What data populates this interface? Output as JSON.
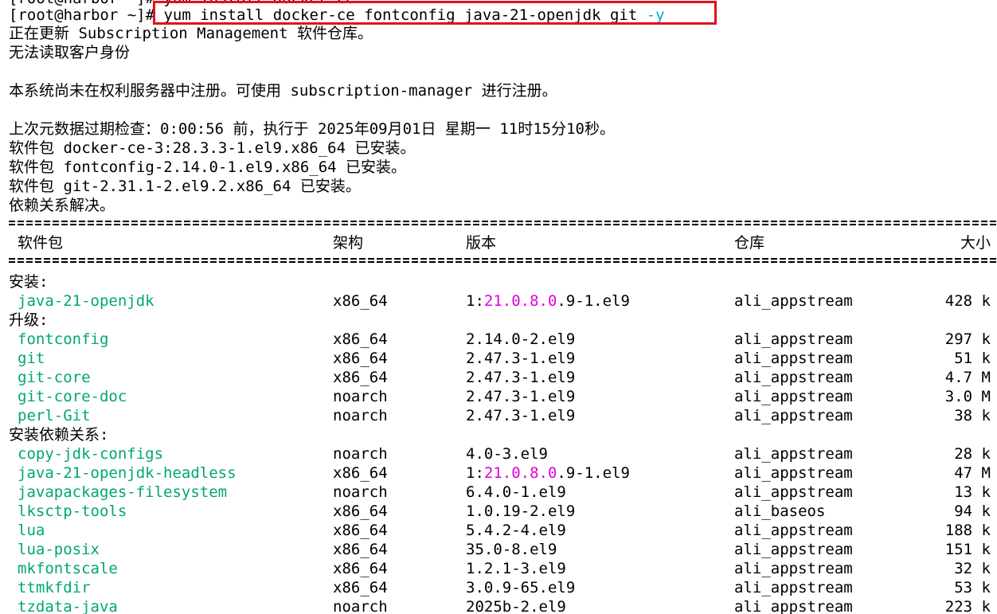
{
  "top_partial": "[root@harbor ~]# yum install docker-ce",
  "prompt": "[root@harbor ~]# ",
  "command": "yum install docker-ce fontconfig java-21-openjdk git ",
  "command_flag": "-y",
  "messages": [
    "正在更新 Subscription Management 软件仓库。",
    "无法读取客户身份",
    "",
    "本系统尚未在权利服务器中注册。可使用 subscription-manager 进行注册。",
    "",
    "上次元数据过期检查：0:00:56 前，执行于 2025年09月01日 星期一 11时15分10秒。",
    "软件包 docker-ce-3:28.3.3-1.el9.x86_64 已安装。",
    "软件包 fontconfig-2.14.0-1.el9.x86_64 已安装。",
    "软件包 git-2.31.1-2.el9.2.x86_64 已安装。",
    "依赖关系解决。"
  ],
  "table_header": {
    "name": "软件包",
    "arch": "架构",
    "version": "版本",
    "repo": "仓库",
    "size": "大小"
  },
  "sections": [
    {
      "title": "安装:",
      "rows": [
        {
          "name": "java-21-openjdk",
          "arch": "x86_64",
          "ver_pre": "1:",
          "ver_hl": "21.0.8.0",
          "ver_post": ".9-1.el9",
          "repo": "ali_appstream",
          "size": "428 k"
        }
      ]
    },
    {
      "title": "升级:",
      "rows": [
        {
          "name": "fontconfig",
          "arch": "x86_64",
          "ver_pre": "2.14.0-2.el9",
          "ver_hl": "",
          "ver_post": "",
          "repo": "ali_appstream",
          "size": "297 k"
        },
        {
          "name": "git",
          "arch": "x86_64",
          "ver_pre": "2.47.3-1.el9",
          "ver_hl": "",
          "ver_post": "",
          "repo": "ali_appstream",
          "size": "51 k"
        },
        {
          "name": "git-core",
          "arch": "x86_64",
          "ver_pre": "2.47.3-1.el9",
          "ver_hl": "",
          "ver_post": "",
          "repo": "ali_appstream",
          "size": "4.7 M"
        },
        {
          "name": "git-core-doc",
          "arch": "noarch",
          "ver_pre": "2.47.3-1.el9",
          "ver_hl": "",
          "ver_post": "",
          "repo": "ali_appstream",
          "size": "3.0 M"
        },
        {
          "name": "perl-Git",
          "arch": "noarch",
          "ver_pre": "2.47.3-1.el9",
          "ver_hl": "",
          "ver_post": "",
          "repo": "ali_appstream",
          "size": "38 k"
        }
      ]
    },
    {
      "title": "安装依赖关系:",
      "rows": [
        {
          "name": "copy-jdk-configs",
          "arch": "noarch",
          "ver_pre": "4.0-3.el9",
          "ver_hl": "",
          "ver_post": "",
          "repo": "ali_appstream",
          "size": "28 k"
        },
        {
          "name": "java-21-openjdk-headless",
          "arch": "x86_64",
          "ver_pre": "1:",
          "ver_hl": "21.0.8.0",
          "ver_post": ".9-1.el9",
          "repo": "ali_appstream",
          "size": "47 M"
        },
        {
          "name": "javapackages-filesystem",
          "arch": "noarch",
          "ver_pre": "6.4.0-1.el9",
          "ver_hl": "",
          "ver_post": "",
          "repo": "ali_appstream",
          "size": "13 k"
        },
        {
          "name": "lksctp-tools",
          "arch": "x86_64",
          "ver_pre": "1.0.19-2.el9",
          "ver_hl": "",
          "ver_post": "",
          "repo": "ali_baseos",
          "size": "94 k"
        },
        {
          "name": "lua",
          "arch": "x86_64",
          "ver_pre": "5.4.2-4.el9",
          "ver_hl": "",
          "ver_post": "",
          "repo": "ali_appstream",
          "size": "188 k"
        },
        {
          "name": "lua-posix",
          "arch": "x86_64",
          "ver_pre": "35.0-8.el9",
          "ver_hl": "",
          "ver_post": "",
          "repo": "ali_appstream",
          "size": "151 k"
        },
        {
          "name": "mkfontscale",
          "arch": "x86_64",
          "ver_pre": "1.2.1-3.el9",
          "ver_hl": "",
          "ver_post": "",
          "repo": "ali_appstream",
          "size": "32 k"
        },
        {
          "name": "ttmkfdir",
          "arch": "x86_64",
          "ver_pre": "3.0.9-65.el9",
          "ver_hl": "",
          "ver_post": "",
          "repo": "ali_appstream",
          "size": "53 k"
        },
        {
          "name": "tzdata-java",
          "arch": "noarch",
          "ver_pre": "2025b-2.el9",
          "ver_hl": "",
          "ver_post": "",
          "repo": "ali_appstream",
          "size": "223 k"
        }
      ]
    }
  ],
  "colors": {
    "package_name": "#00a86b",
    "version_highlight": "#e000e0",
    "flag": "#00a8d0",
    "highlight_box": "#e3101b"
  }
}
